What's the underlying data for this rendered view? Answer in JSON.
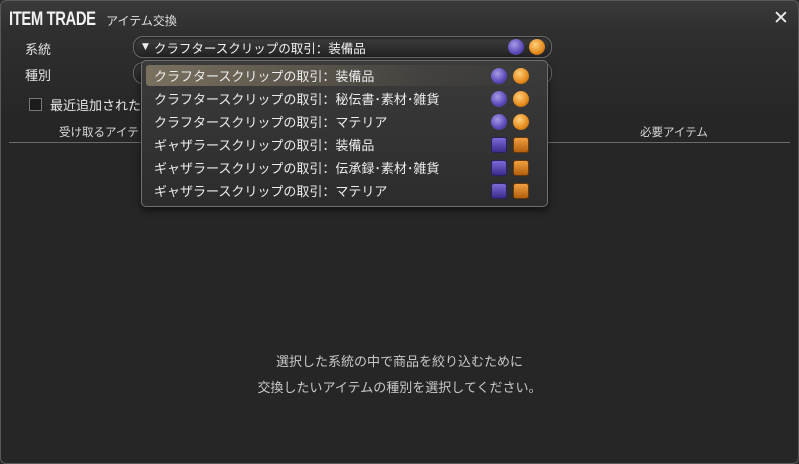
{
  "window": {
    "title": "ITEM TRADE",
    "subtitle": "アイテム交換"
  },
  "filters": {
    "category_label": "系統",
    "category_value": "クラフタースクリップの取引：装備品",
    "type_label": "種別",
    "recent_label": "最近追加された"
  },
  "columns": {
    "receive": "受け取るアイテ",
    "required": "必要アイテム"
  },
  "dropdown": {
    "items": [
      {
        "label": "クラフタースクリップの取引：装備品",
        "icon_a": "crafter-purple-scrip-icon",
        "icon_b": "crafter-orange-scrip-icon"
      },
      {
        "label": "クラフタースクリップの取引：秘伝書･素材･雑貨",
        "icon_a": "crafter-purple-scrip-icon",
        "icon_b": "crafter-orange-scrip-icon"
      },
      {
        "label": "クラフタースクリップの取引：マテリア",
        "icon_a": "crafter-purple-scrip-icon",
        "icon_b": "crafter-orange-scrip-icon"
      },
      {
        "label": "ギャザラースクリップの取引：装備品",
        "icon_a": "gatherer-purple-scrip-icon",
        "icon_b": "gatherer-orange-scrip-icon"
      },
      {
        "label": "ギャザラースクリップの取引：伝承録･素材･雑貨",
        "icon_a": "gatherer-purple-scrip-icon",
        "icon_b": "gatherer-orange-scrip-icon"
      },
      {
        "label": "ギャザラースクリップの取引：マテリア",
        "icon_a": "gatherer-purple-scrip-icon",
        "icon_b": "gatherer-orange-scrip-icon"
      }
    ]
  },
  "hint": {
    "line1": "選択した系統の中で商品を絞り込むために",
    "line2": "交換したいアイテムの種別を選択してください。"
  }
}
